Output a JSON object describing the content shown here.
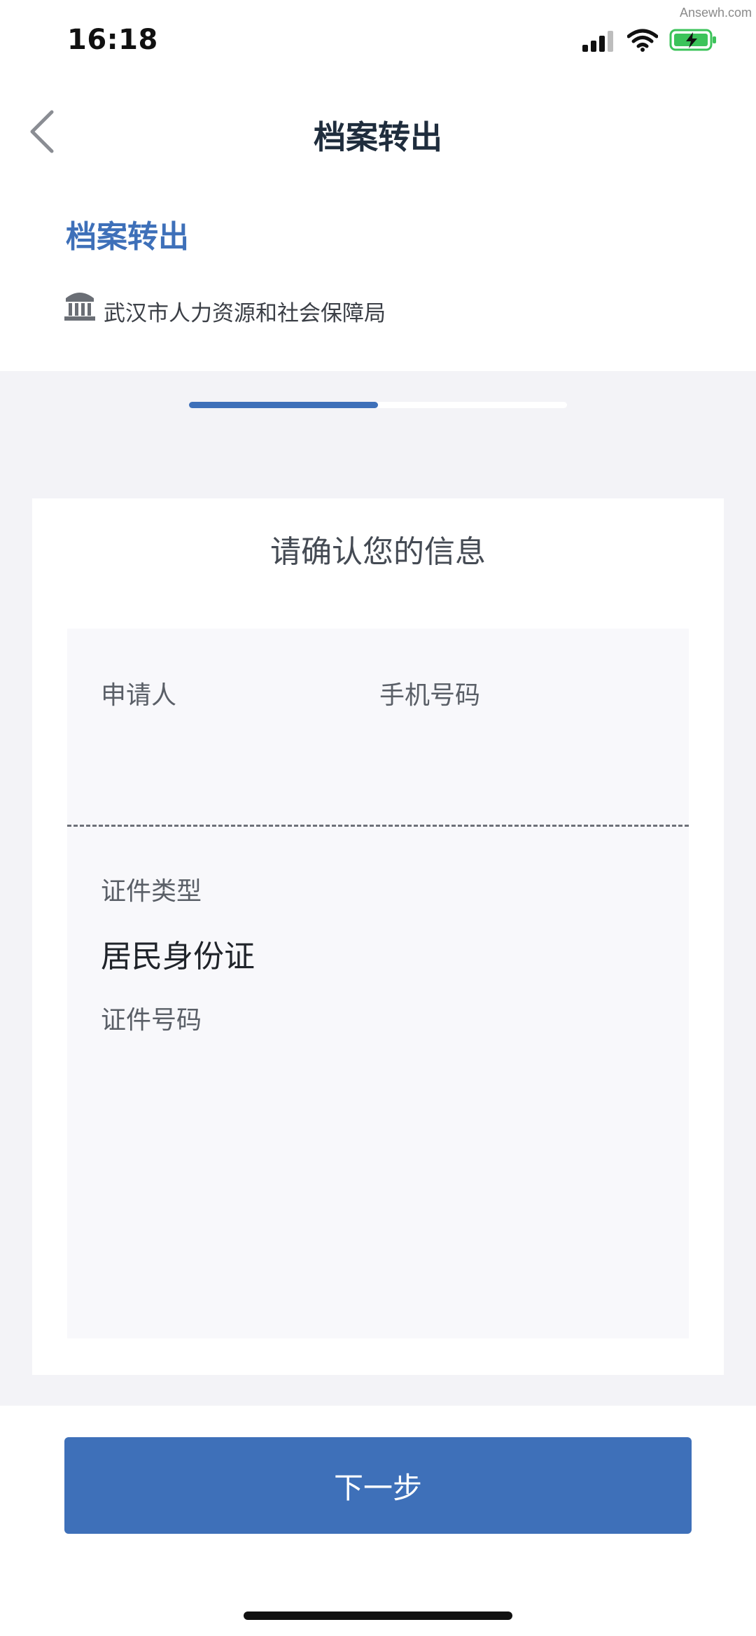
{
  "status_bar": {
    "time": "16:18",
    "watermark": "Ansewh.com",
    "icons": [
      "cellular-signal-icon",
      "wifi-icon",
      "battery-charging-icon"
    ],
    "battery_color": "#3cc35a"
  },
  "nav": {
    "title": "档案转出",
    "back_icon": "chevron-left-icon"
  },
  "header": {
    "service_title": "档案转出",
    "agency_icon": "government-building-icon",
    "agency_name": "武汉市人力资源和社会保障局"
  },
  "progress": {
    "current_step": 1,
    "total_steps": 2,
    "fraction": 0.5
  },
  "card": {
    "title": "请确认您的信息",
    "fields": {
      "applicant_label": "申请人",
      "phone_label": "手机号码",
      "id_type_label": "证件类型",
      "id_type_value": "居民身份证",
      "id_number_label": "证件号码"
    }
  },
  "footer": {
    "next_label": "下一步"
  },
  "colors": {
    "accent": "#3e70b9",
    "page_gray": "#f3f3f7"
  }
}
